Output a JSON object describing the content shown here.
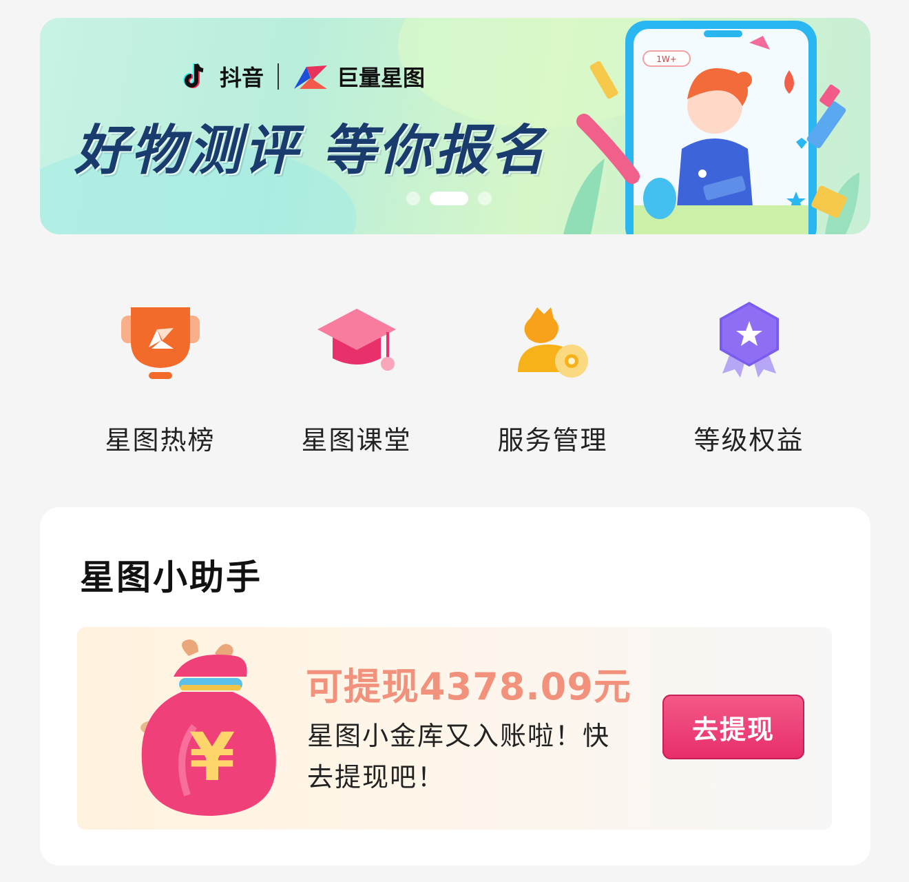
{
  "banner": {
    "brand_douyin": "抖音",
    "brand_xingtu": "巨量星图",
    "title": "好物测评 等你报名",
    "follower_badge": "1W+",
    "dots": {
      "count": 3,
      "active_index": 1
    }
  },
  "entries": [
    {
      "label": "星图热榜",
      "icon": "trophy-icon"
    },
    {
      "label": "星图课堂",
      "icon": "graduation-cap-icon"
    },
    {
      "label": "服务管理",
      "icon": "user-coin-icon"
    },
    {
      "label": "等级权益",
      "icon": "star-badge-icon"
    }
  ],
  "assistant": {
    "title": "星图小助手",
    "amount_text": "可提现4378.09元",
    "description": "星图小金库又入账啦！快去提现吧！",
    "button_label": "去提现",
    "icon": "money-bag-icon"
  },
  "colors": {
    "amount": "#f2917c",
    "button": "#e72d6a",
    "title_dark": "#1a3b6d"
  }
}
